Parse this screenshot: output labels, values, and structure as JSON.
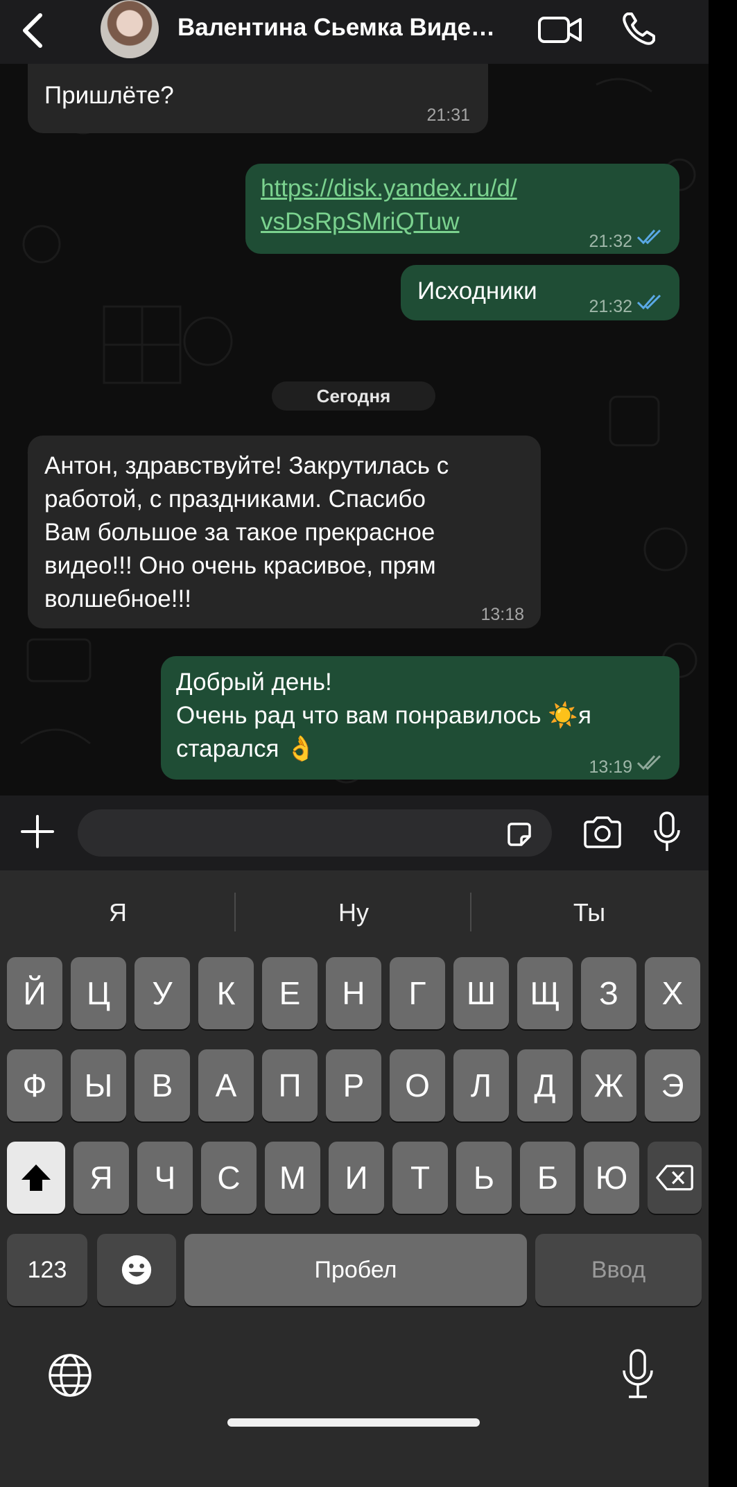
{
  "header": {
    "title": "Валентина Сьемка Виде…",
    "icons": [
      "back-chevron-icon",
      "avatar",
      "video-call-icon",
      "phone-icon"
    ]
  },
  "messages": [
    {
      "dir": "in",
      "text": "Пришлёте?",
      "time": "21:31"
    },
    {
      "dir": "out",
      "text_line1": "https://disk.yandex.ru/d/",
      "text_line2": "vsDsRpSMriQTuw",
      "time": "21:32",
      "status": "read"
    },
    {
      "dir": "out",
      "text": "Исходники",
      "time": "21:32",
      "status": "read"
    },
    {
      "dir": "in",
      "lines": [
        "Антон, здравствуйте! Закрутилась с",
        "работой, с праздниками. Спасибо",
        "Вам большое за такое прекрасное",
        "видео!!! Оно очень красивое, прям",
        "волшебное!!!"
      ],
      "time": "13:18"
    },
    {
      "dir": "out",
      "lines": [
        "Добрый день!",
        "Очень рад что вам понравилось ☀️я",
        "старался 👌"
      ],
      "time": "13:19",
      "status": "delivered"
    }
  ],
  "date_separator": "Сегодня",
  "input": {
    "placeholder": ""
  },
  "keyboard": {
    "suggestions": [
      "Я",
      "Ну",
      "Ты"
    ],
    "row1": [
      "Й",
      "Ц",
      "У",
      "К",
      "Е",
      "Н",
      "Г",
      "Ш",
      "Щ",
      "З",
      "Х"
    ],
    "row2": [
      "Ф",
      "Ы",
      "В",
      "А",
      "П",
      "Р",
      "О",
      "Л",
      "Д",
      "Ж",
      "Э"
    ],
    "row3": [
      "Я",
      "Ч",
      "С",
      "М",
      "И",
      "Т",
      "Ь",
      "Б",
      "Ю"
    ],
    "numbers_label": "123",
    "space_label": "Пробел",
    "enter_label": "Ввод"
  },
  "colors": {
    "outgoing_bubble": "#1f4d35",
    "incoming_bubble": "#262626",
    "link": "#7bd28f",
    "read_check": "#5aa9e6"
  }
}
